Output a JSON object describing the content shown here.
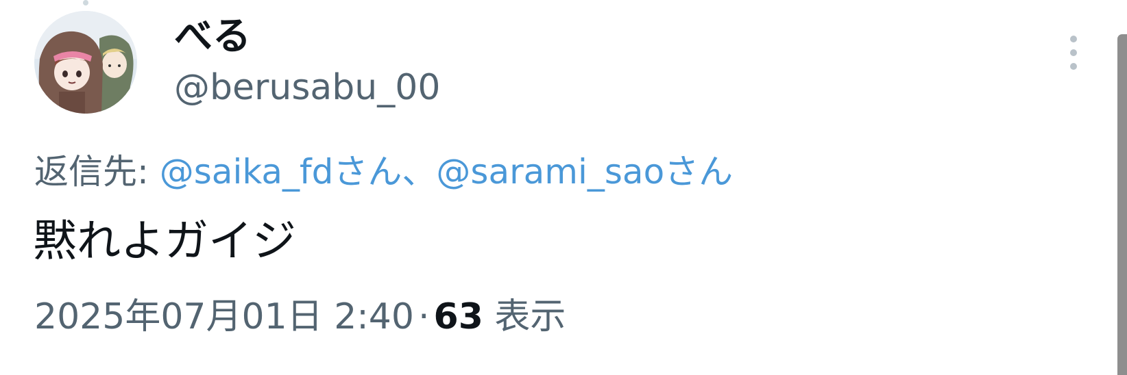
{
  "tweet": {
    "display_name": "べる",
    "handle": "@berusabu_00",
    "reply_prefix": "返信先: ",
    "reply_mentions": [
      "@saika_fdさん",
      "@sarami_saoさん"
    ],
    "reply_separator": "、",
    "text": "黙れよガイジ",
    "timestamp": "2025年07月01日 2:40",
    "meta_separator": "·",
    "views_count": "63",
    "views_label": "表示"
  },
  "icons": {
    "avatar": "profile-avatar",
    "more": "more-vertical-icon"
  },
  "colors": {
    "text_primary": "#0f1419",
    "text_secondary": "#536471",
    "mention": "#4a98d8",
    "scrollbar": "#8e8e8e"
  }
}
